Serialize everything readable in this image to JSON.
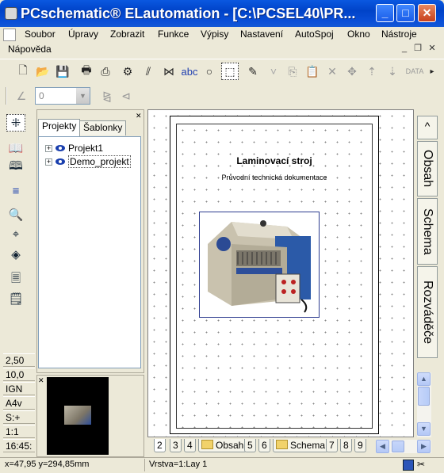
{
  "window": {
    "title": "PCschematic® ELautomation - [C:\\PCSEL40\\PR..."
  },
  "menu": {
    "items": [
      "Soubor",
      "Úpravy",
      "Zobrazit",
      "Funkce",
      "Výpisy",
      "Nastavení",
      "AutoSpoj",
      "Okno",
      "Nástroje"
    ],
    "items_row2": [
      "Nápověda"
    ]
  },
  "toolbar": {
    "text_tool_label": "abc",
    "data_label": "DATA",
    "value_field": "0"
  },
  "status_left": [
    "2,50",
    "10,0",
    "IGN",
    "A4v",
    "S:+",
    "1:1",
    "16:45:"
  ],
  "project_panel": {
    "tabs": [
      "Projekty",
      "Šablonky"
    ],
    "tree": [
      "Projekt1",
      "Demo_projekt"
    ]
  },
  "document": {
    "title": "Laminovací stroj",
    "subtitle": "Průvodní technická dokumentace"
  },
  "right_tabs": [
    "Obsah",
    "Schema",
    "Rozváděče"
  ],
  "bottom_tabs": [
    "2",
    "3",
    "4",
    "Obsah",
    "5",
    "6",
    "Schema",
    "7",
    "8",
    "9"
  ],
  "statusbar": {
    "coords": "x=47,95 y=294,85mm",
    "layer": "Vrstva=1:Lay 1"
  }
}
